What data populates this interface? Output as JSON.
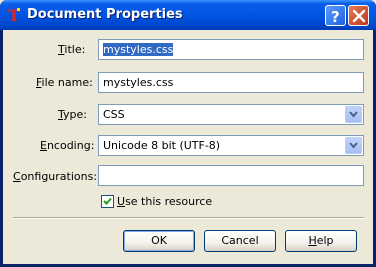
{
  "window": {
    "title": "Document Properties"
  },
  "form": {
    "title_label_pre": "",
    "title_label_acc": "T",
    "title_label_post": "itle:",
    "title_value": "mystyles.css",
    "filename_label_pre": "",
    "filename_label_acc": "F",
    "filename_label_post": "ile name:",
    "filename_value": "mystyles.css",
    "type_label_pre": "",
    "type_label_acc": "T",
    "type_label_post": "ype:",
    "type_value": "CSS",
    "encoding_label_pre": "",
    "encoding_label_acc": "E",
    "encoding_label_post": "ncoding:",
    "encoding_value": "Unicode 8 bit (UTF-8)",
    "config_label_pre": "",
    "config_label_acc": "C",
    "config_label_post": "onfigurations:",
    "config_value": "",
    "use_resource_acc": "U",
    "use_resource_rest": "se this resource",
    "use_resource_checked": true
  },
  "buttons": {
    "ok": "OK",
    "cancel": "Cancel",
    "help_acc": "H",
    "help_rest": "elp"
  }
}
